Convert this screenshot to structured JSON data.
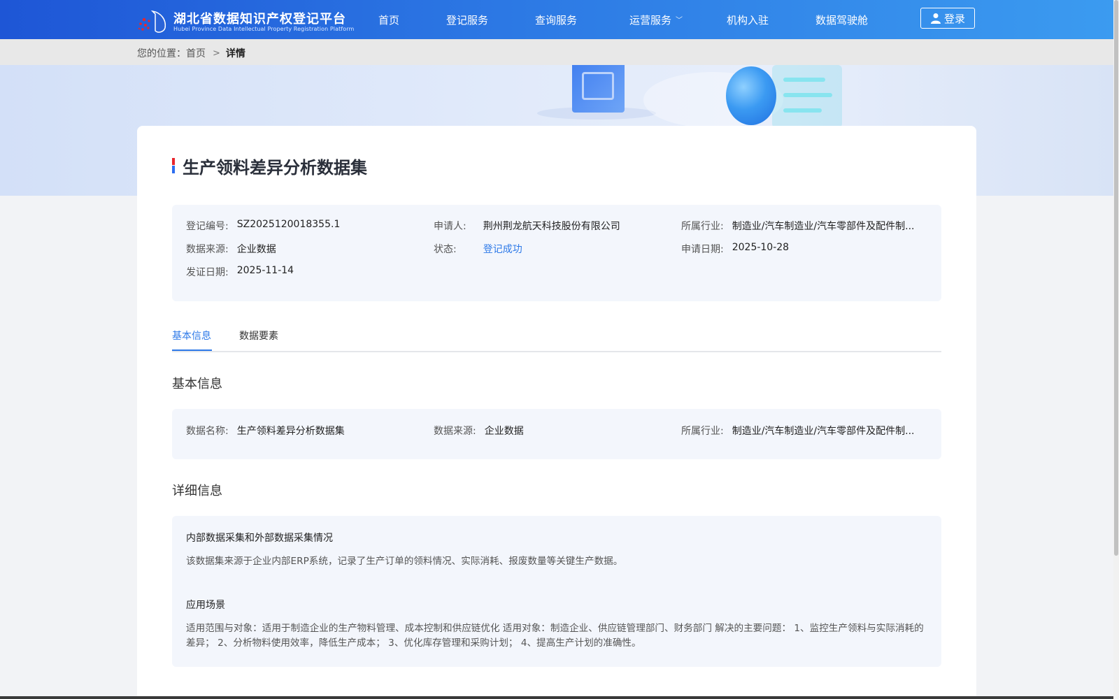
{
  "header": {
    "logo_cn": "湖北省数据知识产权登记平台",
    "logo_en": "Hubei Province Data Intellectual Property Registration Platform",
    "nav": [
      "首页",
      "登记服务",
      "查询服务",
      "运营服务",
      "机构入驻",
      "数据驾驶舱"
    ],
    "login_label": "登录"
  },
  "breadcrumb": {
    "prefix": "您的位置：",
    "home": "首页",
    "current": "详情"
  },
  "page_title": "生产领料差异分析数据集",
  "summary": {
    "reg_no_label": "登记编号:",
    "reg_no": "SZ2025120018355.1",
    "applicant_label": "申请人:",
    "applicant": "荆州荆龙航天科技股份有限公司",
    "industry_label": "所属行业:",
    "industry": "制造业/汽车制造业/汽车零部件及配件制...",
    "source_label": "数据来源:",
    "source": "企业数据",
    "status_label": "状态:",
    "status": "登记成功",
    "apply_date_label": "申请日期:",
    "apply_date": "2025-10-28",
    "issue_date_label": "发证日期:",
    "issue_date": "2025-11-14"
  },
  "tabs": [
    "基本信息",
    "数据要素"
  ],
  "basic": {
    "section_title": "基本信息",
    "name_label": "数据名称:",
    "name": "生产领料差异分析数据集",
    "source_label": "数据来源:",
    "source": "企业数据",
    "industry_label": "所属行业:",
    "industry": "制造业/汽车制造业/汽车零部件及配件制..."
  },
  "detail": {
    "section_title": "详细信息",
    "collection_title": "内部数据采集和外部数据采集情况",
    "collection_text": "该数据集来源于企业内部ERP系统，记录了生产订单的领料情况、实际消耗、报废数量等关键生产数据。",
    "scenario_title": "应用场景",
    "scenario_text": "适用范围与对象：适用于制造企业的生产物料管理、成本控制和供应链优化 适用对象：制造企业、供应链管理部门、财务部门 解决的主要问题： 1、监控生产领料与实际消耗的差异； 2、分析物料使用效率，降低生产成本； 3、优化库存管理和采购计划； 4、提高生产计划的准确性。"
  },
  "colors": {
    "header_start": "#1e56d6",
    "header_end": "#3b9bf0",
    "accent": "#2d79e8",
    "info_bg": "#f3f6fc"
  }
}
